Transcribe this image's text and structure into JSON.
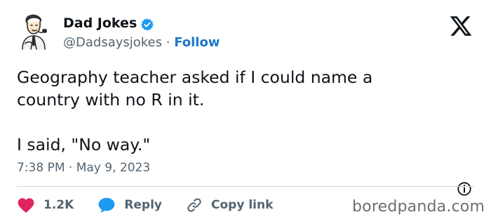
{
  "author": {
    "display_name": "Dad Jokes",
    "handle": "@Dadsaysjokes",
    "separator": " · ",
    "follow_label": "Follow"
  },
  "tweet": {
    "paragraphs": [
      "Geography teacher asked if I could name a\ncountry with no R in it.",
      "I said, \"No way.\""
    ],
    "time": "7:38 PM",
    "date_separator": " · ",
    "date": "May 9, 2023"
  },
  "actions": {
    "like_count": "1.2K",
    "reply_label": "Reply",
    "copy_link_label": "Copy link"
  },
  "watermark": "boredpanda.com",
  "colors": {
    "like": "#e0245e",
    "reply": "#1d9bf0",
    "follow": "#1d77c9",
    "verified": "#1d9bf0",
    "muted": "#536471"
  },
  "icons": {
    "x_logo": "x-logo-icon",
    "verified": "verified-badge-icon",
    "info": "info-icon",
    "like": "heart-icon",
    "reply": "reply-bubble-icon",
    "copy_link": "link-icon"
  }
}
